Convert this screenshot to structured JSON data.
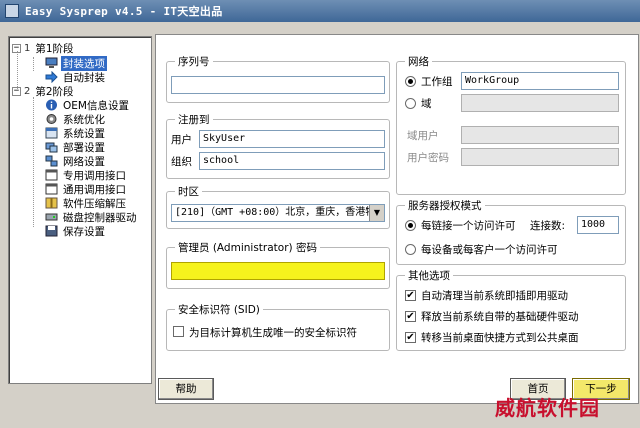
{
  "window": {
    "title": "Easy Sysprep v4.5 - IT天空出品"
  },
  "tree": {
    "stage1": {
      "num": "1",
      "label": "第1阶段"
    },
    "stage1_items": [
      {
        "label": "封装选项",
        "icon": "monitor-icon"
      },
      {
        "label": "自动封装",
        "icon": "arrow-right-icon"
      }
    ],
    "stage2": {
      "num": "2",
      "label": "第2阶段"
    },
    "stage2_items": [
      {
        "label": "OEM信息设置",
        "icon": "info-icon"
      },
      {
        "label": "系统优化",
        "icon": "gear-icon"
      },
      {
        "label": "系统设置",
        "icon": "settings-window-icon"
      },
      {
        "label": "部署设置",
        "icon": "deploy-icon"
      },
      {
        "label": "网络设置",
        "icon": "network-icon"
      },
      {
        "label": "专用调用接口",
        "icon": "window-icon"
      },
      {
        "label": "通用调用接口",
        "icon": "window-icon"
      },
      {
        "label": "软件压缩解压",
        "icon": "archive-icon"
      },
      {
        "label": "磁盘控制器驱动",
        "icon": "disk-icon"
      },
      {
        "label": "保存设置",
        "icon": "save-icon"
      }
    ]
  },
  "serial": {
    "title": "序列号",
    "value": ""
  },
  "register": {
    "title": "注册到",
    "user_label": "用户",
    "user_value": "SkyUser",
    "org_label": "组织",
    "org_value": "school"
  },
  "timezone": {
    "title": "时区",
    "value": "[210]（GMT +08:00）北京，重庆，香港特"
  },
  "admin": {
    "title": "管理员 (Administrator) 密码",
    "value": ""
  },
  "sid": {
    "title": "安全标识符 (SID)",
    "option": "为目标计算机生成唯一的安全标识符",
    "checked": false
  },
  "network": {
    "title": "网络",
    "workgroup_label": "工作组",
    "workgroup_value": "WorkGroup",
    "workgroup_selected": true,
    "domain_label": "域",
    "domain_value": "",
    "domain_user_label": "域用户",
    "domain_user_value": "",
    "domain_pwd_label": "用户密码",
    "domain_pwd_value": ""
  },
  "license": {
    "title": "服务器授权模式",
    "per_server_label": "每链接一个访问许可",
    "connections_label": "连接数:",
    "connections_value": "1000",
    "per_seat_label": "每设备或每客户一个访问许可",
    "per_server_selected": true
  },
  "other": {
    "title": "其他选项",
    "options": [
      {
        "label": "自动清理当前系统即插即用驱动",
        "checked": true
      },
      {
        "label": "释放当前系统自带的基础硬件驱动",
        "checked": true
      },
      {
        "label": "转移当前桌面快捷方式到公共桌面",
        "checked": true
      }
    ]
  },
  "buttons": {
    "help": "帮助",
    "home": "首页",
    "next": "下一步"
  },
  "watermark": "威航软件园",
  "check_mark": "✔",
  "colors": {
    "accent": "#316ac5",
    "highlight": "#f6f31d",
    "watermark": "#c8102e"
  }
}
